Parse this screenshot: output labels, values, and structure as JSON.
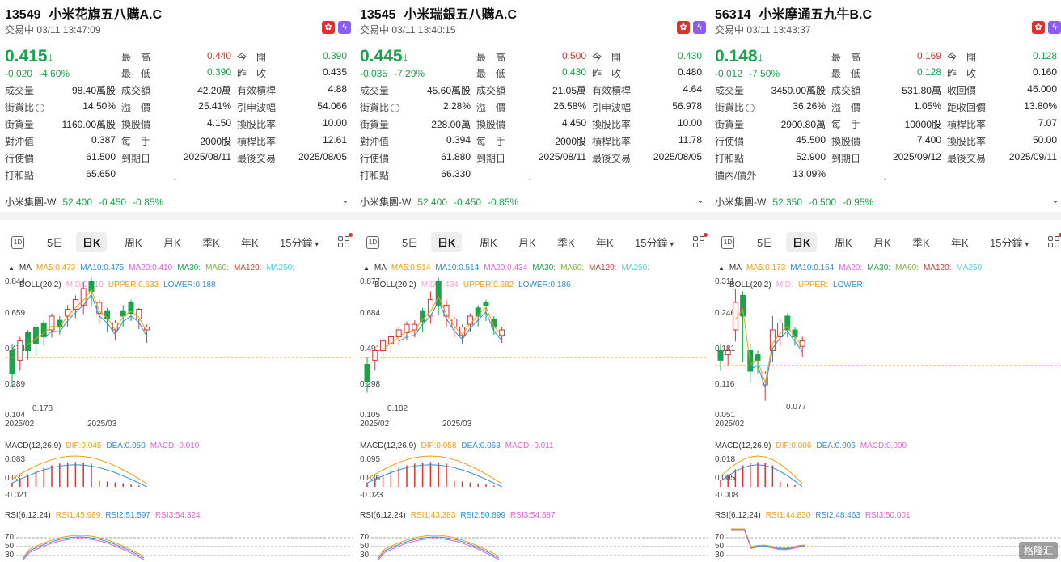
{
  "panels": [
    {
      "code": "13549",
      "name": "小米花旗五八購A.C",
      "status": "交易中 03/11 13:47:09",
      "price": "0.415",
      "change": "-0.020",
      "change_pct": "-4.60%",
      "rows": [
        [
          {
            "l": "最　高",
            "v": "0.440",
            "c": "red"
          },
          {
            "l": "今　開",
            "v": "0.390",
            "c": "green"
          }
        ],
        [
          {
            "l": "最　低",
            "v": "0.390",
            "c": "green"
          },
          {
            "l": "昨　收",
            "v": "0.435",
            "c": ""
          }
        ],
        [
          {
            "l0": "成交量",
            "v0": "98.40萬股"
          },
          {
            "l": "成交額",
            "v": "42.20萬",
            "c": ""
          },
          {
            "l": "有效槓桿",
            "v": "4.88",
            "c": ""
          }
        ],
        [
          {
            "l0": "街貨比",
            "v0": "14.50%",
            "info": true
          },
          {
            "l": "溢　價",
            "v": "25.41%",
            "c": ""
          },
          {
            "l": "引申波幅",
            "v": "54.066",
            "c": ""
          }
        ],
        [
          {
            "l0": "街貨量",
            "v0": "1160.00萬股"
          },
          {
            "l": "換股價",
            "v": "4.150",
            "c": ""
          },
          {
            "l": "換股比率",
            "v": "10.00",
            "c": ""
          }
        ],
        [
          {
            "l0": "對沖值",
            "v0": "0.387"
          },
          {
            "l": "每　手",
            "v": "2000股",
            "c": ""
          },
          {
            "l": "槓桿比率",
            "v": "12.61",
            "c": ""
          }
        ],
        [
          {
            "l0": "行使價",
            "v0": "61.500"
          },
          {
            "l": "到期日",
            "v": "2025/08/11",
            "c": ""
          },
          {
            "l": "最後交易",
            "v": "2025/08/05",
            "c": ""
          }
        ],
        [
          {
            "l0": "打和點",
            "v0": "65.650"
          }
        ]
      ],
      "underlying": {
        "name": "小米集團-W",
        "price": "52.400",
        "chg": "-0.450",
        "pct": "-0.85%"
      },
      "ma": {
        "label": "MA",
        "ma5": "MA5:0.473",
        "ma10": "MA10:0.475",
        "ma20": "MA20:0.410",
        "ma30": "MA30:",
        "ma60": "MA60:",
        "ma120": "MA120:",
        "ma250": "MA250:"
      },
      "boll": {
        "label": "BOLL(20,2)",
        "mid": "MID:0.410",
        "upper": "UPPER:0.633",
        "lower": "LOWER:0.188"
      },
      "yticks": [
        "0.844",
        "0.659",
        "0.474",
        "0.289",
        "0.104"
      ],
      "xticks": [
        "2025/02",
        "2025/03"
      ],
      "low_mark": "0.178",
      "macd": {
        "label": "MACD(12,26,9)",
        "dif": "DIF:0.045",
        "dea": "DEA:0.050",
        "macd": "MACD:-0.010",
        "ticks": [
          "0.083",
          "0.031",
          "-0.021"
        ]
      },
      "rsi": {
        "label": "RSI(6,12,24)",
        "r1": "RSI1:45.989",
        "r2": "RSI2:51.597",
        "r3": "RSI3:54.324",
        "ticks": [
          "70",
          "50",
          "30"
        ]
      }
    },
    {
      "code": "13545",
      "name": "小米瑞銀五八購A.C",
      "status": "交易中 03/11 13:40:15",
      "price": "0.445",
      "change": "-0.035",
      "change_pct": "-7.29%",
      "rows": [
        [
          {
            "l": "最　高",
            "v": "0.500",
            "c": "red"
          },
          {
            "l": "今　開",
            "v": "0.430",
            "c": "green"
          }
        ],
        [
          {
            "l": "最　低",
            "v": "0.430",
            "c": "green"
          },
          {
            "l": "昨　收",
            "v": "0.480",
            "c": ""
          }
        ],
        [
          {
            "l0": "成交量",
            "v0": "45.60萬股"
          },
          {
            "l": "成交額",
            "v": "21.05萬",
            "c": ""
          },
          {
            "l": "有效槓桿",
            "v": "4.64",
            "c": ""
          }
        ],
        [
          {
            "l0": "街貨比",
            "v0": "2.28%",
            "info": true
          },
          {
            "l": "溢　價",
            "v": "26.58%",
            "c": ""
          },
          {
            "l": "引申波幅",
            "v": "56.978",
            "c": ""
          }
        ],
        [
          {
            "l0": "街貨量",
            "v0": "228.00萬"
          },
          {
            "l": "換股價",
            "v": "4.450",
            "c": ""
          },
          {
            "l": "換股比率",
            "v": "10.00",
            "c": ""
          }
        ],
        [
          {
            "l0": "對沖值",
            "v0": "0.394"
          },
          {
            "l": "每　手",
            "v": "2000股",
            "c": ""
          },
          {
            "l": "槓桿比率",
            "v": "11.78",
            "c": ""
          }
        ],
        [
          {
            "l0": "行使價",
            "v0": "61.880"
          },
          {
            "l": "到期日",
            "v": "2025/08/11",
            "c": ""
          },
          {
            "l": "最後交易",
            "v": "2025/08/05",
            "c": ""
          }
        ],
        [
          {
            "l0": "打和點",
            "v0": "66.330"
          }
        ]
      ],
      "underlying": {
        "name": "小米集團-W",
        "price": "52.400",
        "chg": "-0.450",
        "pct": "-0.85%"
      },
      "ma": {
        "label": "MA",
        "ma5": "MA5:0.514",
        "ma10": "MA10:0.514",
        "ma20": "MA20:0.434",
        "ma30": "MA30:",
        "ma60": "MA60:",
        "ma120": "MA120:",
        "ma250": "MA250:"
      },
      "boll": {
        "label": "BOLL(20,2)",
        "mid": "MID:0.434",
        "upper": "UPPER:0.682",
        "lower": "LOWER:0.186"
      },
      "yticks": [
        "0.877",
        "0.684",
        "0.491",
        "0.298",
        "0.105"
      ],
      "xticks": [
        "2025/02",
        "2025/03"
      ],
      "low_mark": "0.182",
      "macd": {
        "label": "MACD(12,26,9)",
        "dif": "DIF:0.058",
        "dea": "DEA:0.063",
        "macd": "MACD:-0.011",
        "ticks": [
          "0.095",
          "0.036",
          "-0.023"
        ]
      },
      "rsi": {
        "label": "RSI(6,12,24)",
        "r1": "RSI1:43.383",
        "r2": "RSI2:50.899",
        "r3": "RSI3:54.587",
        "ticks": [
          "70",
          "50",
          "30"
        ]
      }
    },
    {
      "code": "56314",
      "name": "小米摩通五九牛B.C",
      "status": "交易中 03/11 13:43:37",
      "price": "0.148",
      "change": "-0.012",
      "change_pct": "-7.50%",
      "rows": [
        [
          {
            "l": "最　高",
            "v": "0.169",
            "c": "red"
          },
          {
            "l": "今　開",
            "v": "0.128",
            "c": "green"
          }
        ],
        [
          {
            "l": "最　低",
            "v": "0.128",
            "c": "green"
          },
          {
            "l": "昨　收",
            "v": "0.160",
            "c": ""
          }
        ],
        [
          {
            "l0": "成交量",
            "v0": "3450.00萬股"
          },
          {
            "l": "成交額",
            "v": "531.80萬",
            "c": ""
          },
          {
            "l": "收回價",
            "v": "46.000",
            "c": ""
          }
        ],
        [
          {
            "l0": "街貨比",
            "v0": "36.26%",
            "info": true
          },
          {
            "l": "溢　價",
            "v": "1.05%",
            "c": ""
          },
          {
            "l": "距收回價",
            "v": "13.80%",
            "c": ""
          }
        ],
        [
          {
            "l0": "街貨量",
            "v0": "2900.80萬"
          },
          {
            "l": "每　手",
            "v": "10000股",
            "c": ""
          },
          {
            "l": "槓桿比率",
            "v": "7.07",
            "c": ""
          }
        ],
        [
          {
            "l0": "行使價",
            "v0": "45.500"
          },
          {
            "l": "換股價",
            "v": "7.400",
            "c": ""
          },
          {
            "l": "換股比率",
            "v": "50.00",
            "c": ""
          }
        ],
        [
          {
            "l0": "打和點",
            "v0": "52.900"
          },
          {
            "l": "到期日",
            "v": "2025/09/12",
            "c": ""
          },
          {
            "l": "最後交易",
            "v": "2025/09/11",
            "c": ""
          }
        ],
        [
          {
            "l0": "價內/價外",
            "v0": "13.09%"
          }
        ]
      ],
      "underlying": {
        "name": "小米集團-W",
        "price": "52.350",
        "chg": "-0.500",
        "pct": "-0.95%"
      },
      "ma": {
        "label": "MA",
        "ma5": "MA5:0.173",
        "ma10": "MA10:0.164",
        "ma20": "MA20:",
        "ma30": "MA30:",
        "ma60": "MA60:",
        "ma120": "MA120:",
        "ma250": "MA250:"
      },
      "boll": {
        "label": "BOLL(20,2)",
        "mid": "MID:",
        "upper": "UPPER:",
        "lower": "LOWER:"
      },
      "yticks": [
        "0.311",
        "0.246",
        "0.181",
        "0.116",
        "0.051"
      ],
      "xticks": [
        "2025/02"
      ],
      "low_mark": "0.077",
      "macd": {
        "label": "MACD(12,26,9)",
        "dif": "DIF:0.006",
        "dea": "DEA:0.006",
        "macd": "MACD:0.000",
        "ticks": [
          "0.018",
          "0.005",
          "-0.008"
        ]
      },
      "rsi": {
        "label": "RSI(6,12,24)",
        "r1": "RSI1:44.830",
        "r2": "RSI2:48.463",
        "r3": "RSI3:50.001",
        "ticks": [
          "70",
          "50",
          "30"
        ]
      }
    }
  ],
  "tabs": [
    "5日",
    "日K",
    "周K",
    "月K",
    "季K",
    "年K",
    "15分鐘"
  ],
  "tab_1d": "1D",
  "watermark": "格隆汇",
  "colors": {
    "up": "#1aa34a",
    "down": "#e0312f",
    "ma5": "#f39c12",
    "ma10": "#2f8fd8",
    "ma20": "#e65fd5",
    "ma30": "#1aa34a",
    "ma60": "#7cb342",
    "ma120": "#e0312f",
    "ma250": "#4dd0e1"
  }
}
